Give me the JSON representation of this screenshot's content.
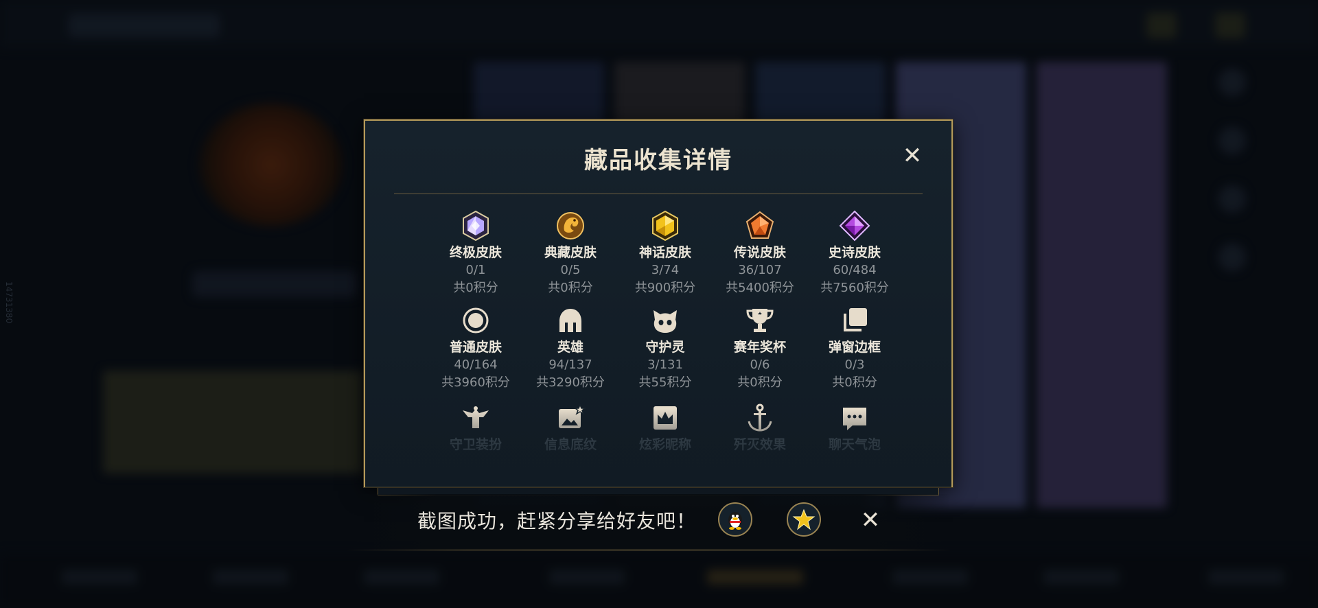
{
  "background": {
    "side_label": "14731380"
  },
  "modal": {
    "title": "藏品收集详情",
    "close_label": "✕",
    "items": [
      {
        "label": "终极皮肤",
        "count": "0/1",
        "points": "共0积分",
        "icon": "ultimate-gem-icon",
        "color": "#b8a8ff"
      },
      {
        "label": "典藏皮肤",
        "count": "0/5",
        "points": "共0积分",
        "icon": "dragon-emblem-icon",
        "color": "#e0a030"
      },
      {
        "label": "神话皮肤",
        "count": "3/74",
        "points": "共900积分",
        "icon": "mythic-gem-icon",
        "color": "#f2c21c"
      },
      {
        "label": "传说皮肤",
        "count": "36/107",
        "points": "共5400积分",
        "icon": "legendary-gem-icon",
        "color": "#f07a30"
      },
      {
        "label": "史诗皮肤",
        "count": "60/484",
        "points": "共7560积分",
        "icon": "epic-gem-icon",
        "color": "#b44ae0"
      },
      {
        "label": "普通皮肤",
        "count": "40/164",
        "points": "共3960积分",
        "icon": "ring-icon",
        "color": "#e6dccb"
      },
      {
        "label": "英雄",
        "count": "94/137",
        "points": "共3290积分",
        "icon": "helmet-icon",
        "color": "#e6dccb"
      },
      {
        "label": "守护灵",
        "count": "3/131",
        "points": "共55积分",
        "icon": "spirit-pet-icon",
        "color": "#e6dccb"
      },
      {
        "label": "赛年奖杯",
        "count": "0/6",
        "points": "共0积分",
        "icon": "trophy-icon",
        "color": "#e6dccb"
      },
      {
        "label": "弹窗边框",
        "count": "0/3",
        "points": "共0积分",
        "icon": "frame-stack-icon",
        "color": "#e6dccb"
      },
      {
        "label": "守卫装扮",
        "icon": "guardian-icon",
        "color": "#e6dccb"
      },
      {
        "label": "信息底纹",
        "icon": "image-star-icon",
        "color": "#e6dccb"
      },
      {
        "label": "炫彩昵称",
        "icon": "crown-card-icon",
        "color": "#e6dccb"
      },
      {
        "label": "歼灭效果",
        "icon": "anchor-icon",
        "color": "#e6dccb"
      },
      {
        "label": "聊天气泡",
        "icon": "chat-bubble-icon",
        "color": "#e6dccb"
      }
    ]
  },
  "toast": {
    "message": "截图成功，赶紧分享给好友吧！",
    "share_qq_icon": "qq-penguin-icon",
    "share_star_icon": "star-badge-icon",
    "close_label": "✕"
  }
}
